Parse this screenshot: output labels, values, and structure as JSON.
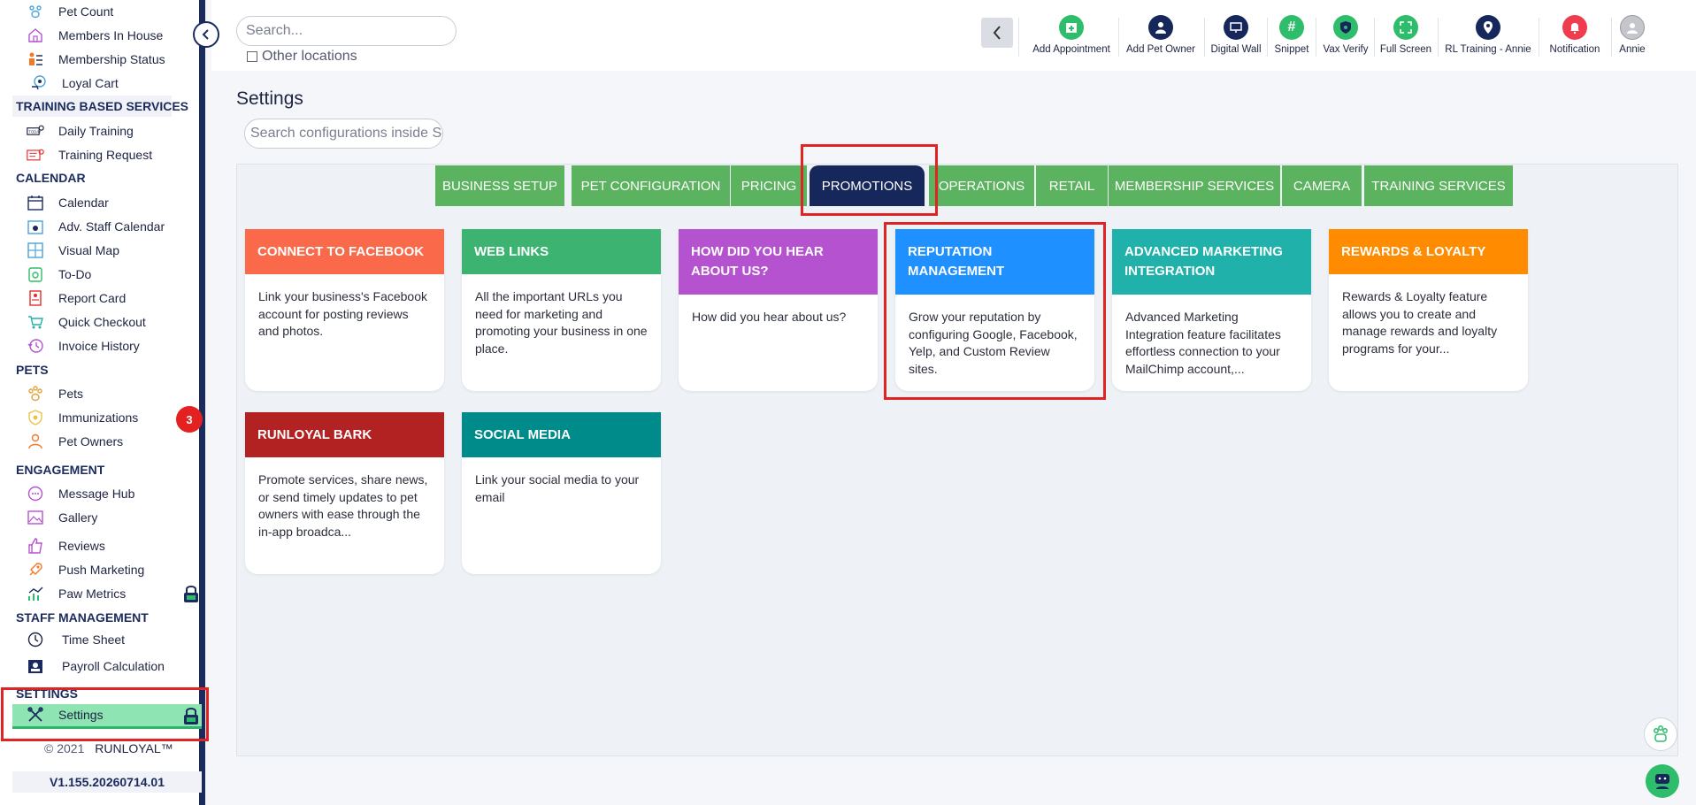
{
  "sidebar": {
    "items_top": [
      {
        "label": "Pet Count",
        "icon": "paw-count-icon"
      },
      {
        "label": "Members In House",
        "icon": "house-icon"
      },
      {
        "label": "Membership Status",
        "icon": "membership-icon"
      },
      {
        "label": "Loyal Cart",
        "icon": "cart-icon"
      }
    ],
    "section_training": "TRAINING BASED SERVICES",
    "training": [
      {
        "label": "Daily Training",
        "icon": "daily-training-icon"
      },
      {
        "label": "Training Request",
        "icon": "training-request-icon"
      }
    ],
    "section_calendar": "CALENDAR",
    "calendar": [
      {
        "label": "Calendar",
        "icon": "calendar-icon"
      },
      {
        "label": "Adv. Staff Calendar",
        "icon": "staff-calendar-icon"
      },
      {
        "label": "Visual Map",
        "icon": "map-icon"
      },
      {
        "label": "To-Do",
        "icon": "todo-icon"
      },
      {
        "label": "Report Card",
        "icon": "report-card-icon"
      },
      {
        "label": "Quick Checkout",
        "icon": "checkout-icon"
      },
      {
        "label": "Invoice History",
        "icon": "invoice-icon"
      }
    ],
    "section_pets": "PETS",
    "pets": [
      {
        "label": "Pets",
        "icon": "paw-icon"
      },
      {
        "label": "Immunizations",
        "icon": "shield-icon"
      },
      {
        "label": "Pet Owners",
        "icon": "person-icon"
      }
    ],
    "immunizations_badge": "3",
    "section_engagement": "ENGAGEMENT",
    "engagement": [
      {
        "label": "Message Hub",
        "icon": "message-icon"
      },
      {
        "label": "Gallery",
        "icon": "gallery-icon"
      },
      {
        "label": "Reviews",
        "icon": "thumbs-up-icon"
      },
      {
        "label": "Push Marketing",
        "icon": "rocket-icon"
      },
      {
        "label": "Paw Metrics",
        "icon": "chart-icon"
      }
    ],
    "section_staff": "STAFF MANAGEMENT",
    "staff": [
      {
        "label": "Time Sheet",
        "icon": "clock-icon"
      },
      {
        "label": "Payroll Calculation",
        "icon": "payroll-icon"
      }
    ],
    "section_settings": "SETTINGS",
    "settings_label": "Settings",
    "copyright": "© 2021",
    "brand": "RUNLOYAL™",
    "version": "V1.155.20260714.01"
  },
  "topbar": {
    "search_placeholder": "Search...",
    "other_locations": "Other locations",
    "actions": [
      {
        "label": "Add Appointment",
        "icon": "calendar-plus-icon",
        "color": "#2ebd6b"
      },
      {
        "label": "Add Pet Owner",
        "icon": "add-person-icon",
        "color": "#16275b"
      },
      {
        "label": "Digital Wall",
        "icon": "monitor-icon",
        "color": "#16275b"
      },
      {
        "label": "Snippet",
        "icon": "hash-icon",
        "color": "#2ebd6b"
      },
      {
        "label": "Vax Verify",
        "icon": "vax-shield-icon",
        "color": "#2ebd6b"
      },
      {
        "label": "Full Screen",
        "icon": "expand-icon",
        "color": "#2ebd6b"
      },
      {
        "label": "RL Training - Annie",
        "icon": "location-pin-icon",
        "color": "#16275b"
      },
      {
        "label": "Notification",
        "icon": "bell-icon",
        "color": "#f03c4f"
      },
      {
        "label": "Annie",
        "icon": "avatar-icon",
        "color": "#c4c6cc"
      }
    ]
  },
  "main": {
    "title": "Settings",
    "config_search_placeholder": "Search configurations inside Settings",
    "tabs": [
      "BUSINESS SETUP",
      "PET CONFIGURATION",
      "PRICING",
      "PROMOTIONS",
      "OPERATIONS",
      "RETAIL",
      "MEMBERSHIP SERVICES",
      "CAMERA",
      "TRAINING SERVICES"
    ],
    "active_tab": "PROMOTIONS",
    "cards": [
      {
        "title": "CONNECT TO FACEBOOK",
        "desc": "Link your business's Facebook account for posting reviews and photos.",
        "color": "#fa6a4a"
      },
      {
        "title": "WEB LINKS",
        "desc": "All the important URLs you need for marketing and promoting your business in one place.",
        "color": "#3cb371"
      },
      {
        "title": "HOW DID YOU HEAR ABOUT US?",
        "desc": "How did you hear about us?",
        "color": "#b552d0"
      },
      {
        "title": "REPUTATION MANAGEMENT",
        "desc": "Grow your reputation by configuring Google, Facebook, Yelp, and Custom Review sites.",
        "color": "#1e90ff"
      },
      {
        "title": "ADVANCED MARKETING INTEGRATION",
        "desc": "Advanced Marketing Integration feature facilitates effortless connection to your MailChimp account,...",
        "color": "#20b2aa"
      },
      {
        "title": "REWARDS & LOYALTY",
        "desc": "Rewards & Loyalty feature allows you to create and manage rewards and loyalty programs for your...",
        "color": "#ff8c00"
      },
      {
        "title": "RUNLOYAL BARK",
        "desc": "Promote services, share news, or send timely updates to pet owners with ease through the in-app broadca...",
        "color": "#b22222"
      },
      {
        "title": "SOCIAL MEDIA",
        "desc": "Link your social media to your email",
        "color": "#008b8b"
      }
    ]
  }
}
